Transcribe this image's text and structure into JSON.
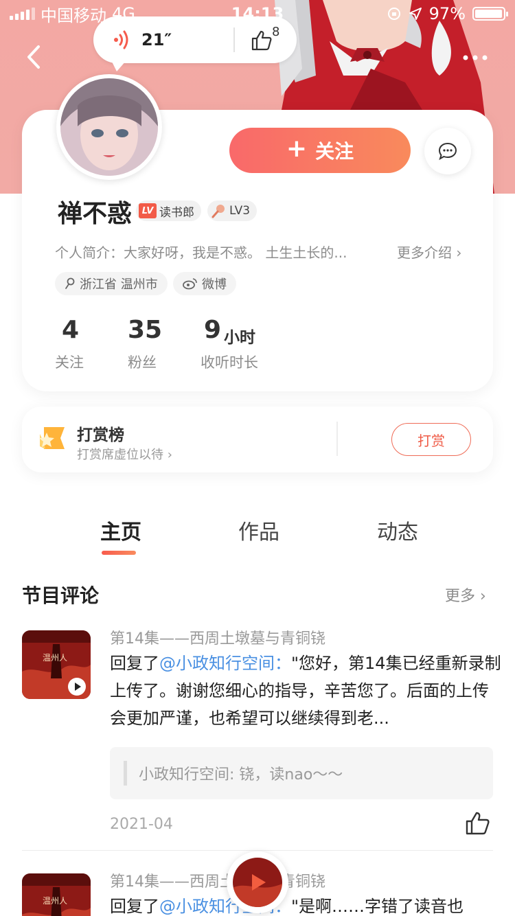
{
  "status_bar": {
    "carrier": "中国移动",
    "network": "4G",
    "time": "14:13",
    "battery": "97%",
    "battery_level": 0.97
  },
  "voice_intro": {
    "duration": "21″",
    "like_count": "8"
  },
  "header": {
    "follow_label": "关注"
  },
  "profile": {
    "nickname": "禅不惑",
    "badges": [
      {
        "icon": "lv-book-badge-icon",
        "label": "读书郎"
      },
      {
        "icon": "microphone-icon",
        "label": "LV3"
      }
    ],
    "intro": "个人简介：大家好呀，我是不惑。 土生土长的...",
    "intro_more": "更多介绍",
    "location": "浙江省 温州市",
    "weibo": "微博"
  },
  "stats": [
    {
      "value": "4",
      "unit": "",
      "label": "关注"
    },
    {
      "value": "35",
      "unit": "",
      "label": "粉丝"
    },
    {
      "value": "9",
      "unit": "小时",
      "label": "收听时长"
    }
  ],
  "reward": {
    "title": "打赏榜",
    "subtitle": "打赏席虚位以待",
    "button": "打赏"
  },
  "tabs": [
    {
      "label": "主页",
      "active": true
    },
    {
      "label": "作品",
      "active": false
    },
    {
      "label": "动态",
      "active": false
    }
  ],
  "comments_section": {
    "title": "节目评论",
    "more": "更多",
    "items": [
      {
        "episode": "第14集——西周土墩墓与青铜铙",
        "reply_prefix": "回复了",
        "mention": "@小政知行空间：",
        "text": "\"您好，第14集已经重新录制上传了。谢谢您细心的指导，辛苦您了。后面的上传会更加严谨，也希望可以继续得到老...",
        "quote": "小政知行空间: 铙，读nao～～",
        "date": "2021-04"
      },
      {
        "episode": "第14集——西周土墩墓与青铜铙",
        "reply_prefix": "回复了",
        "mention": "@小政知行空间：",
        "text": "\"是啊……字错了读音也"
      }
    ]
  },
  "cover_text": "温州人",
  "colors": {
    "accent": "#f9696a",
    "accent_end": "#f98a5c",
    "hero_bg": "#f3a8a3",
    "mention": "#4a90e2"
  }
}
